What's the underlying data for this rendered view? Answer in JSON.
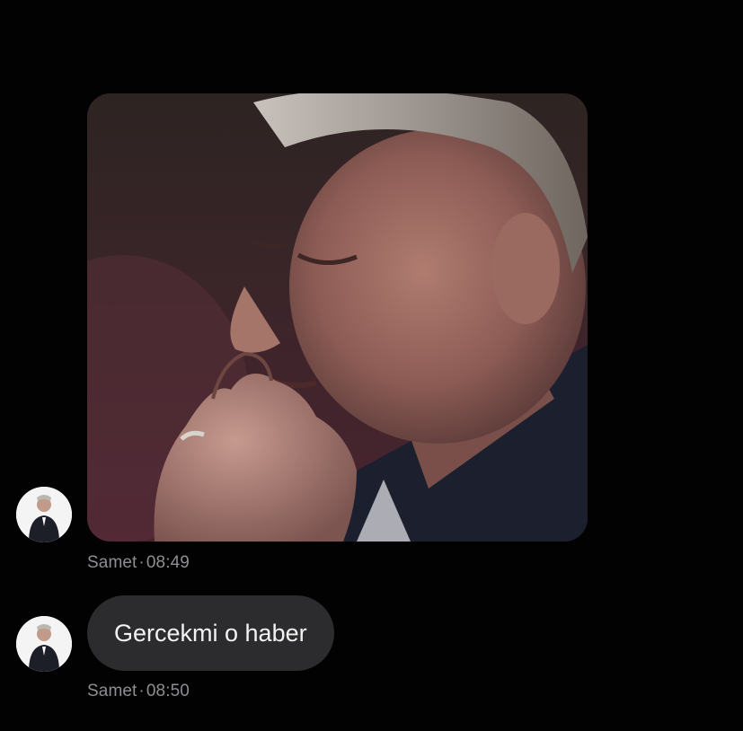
{
  "messages": [
    {
      "type": "image",
      "image_description_icon": "photo-of-man-biting-fingernail",
      "sender": "Samet",
      "time": "08:49"
    },
    {
      "type": "text",
      "text": "Gercekmi o haber",
      "sender": "Samet",
      "time": "08:50"
    }
  ],
  "colors": {
    "background": "#020202",
    "bubble": "#2c2c2e",
    "meta_text": "#8e8e93",
    "message_text": "#f2f2f2"
  }
}
